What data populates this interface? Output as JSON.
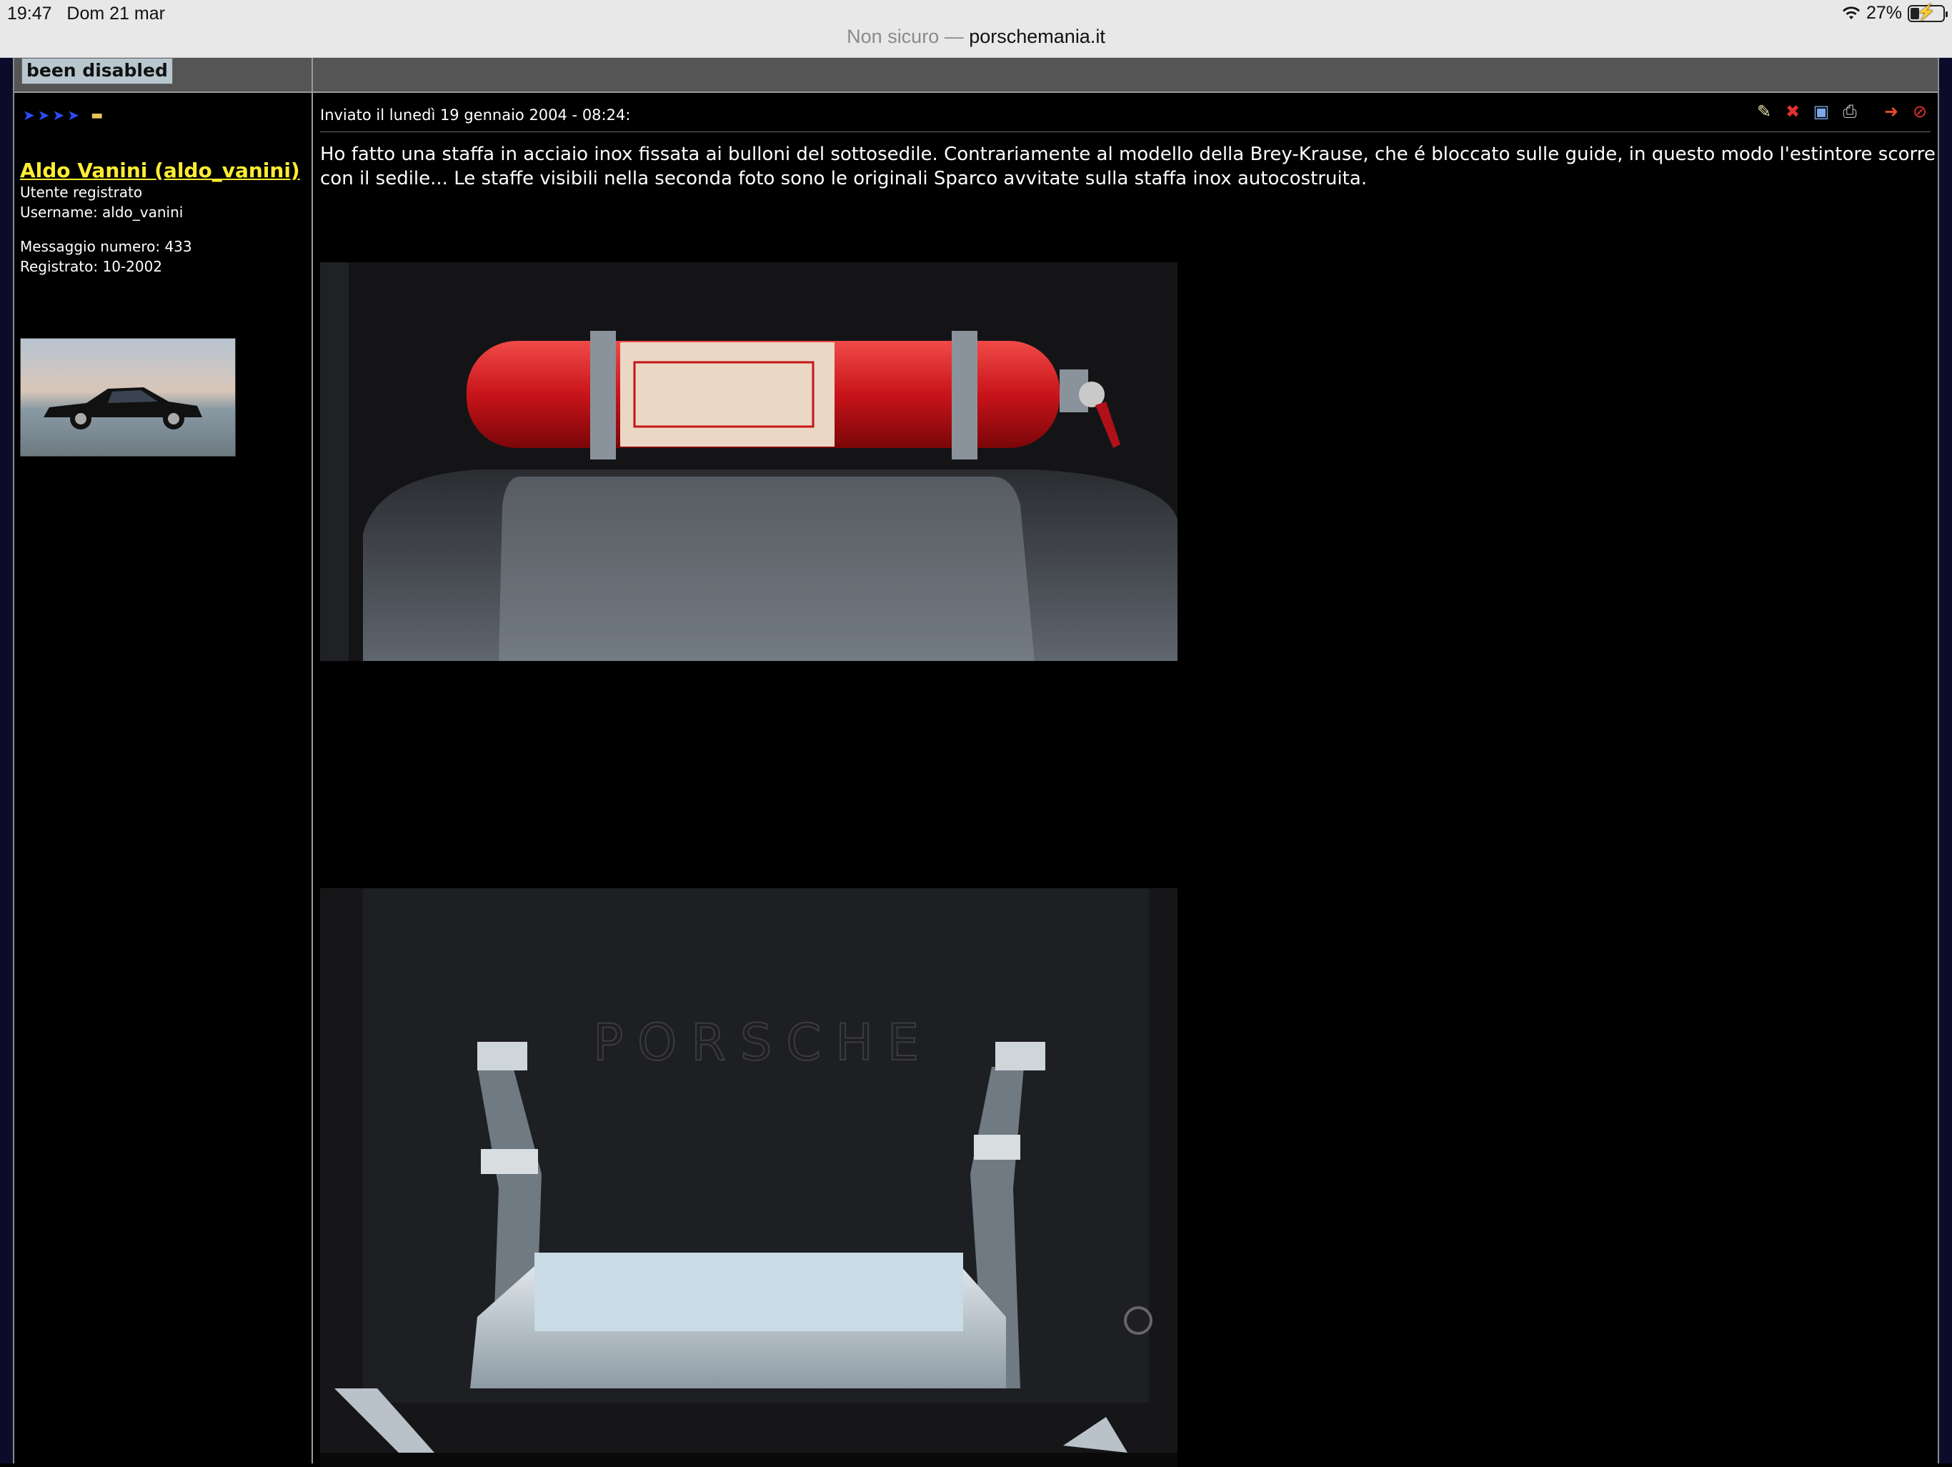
{
  "status_bar": {
    "time": "19:47",
    "date": "Dom 21 mar",
    "battery": "27%",
    "battery_level": 0.27
  },
  "browser": {
    "security_label": "Non sicuro —",
    "domain": "porschemania.it"
  },
  "forum": {
    "disabled_notice": "been disabled"
  },
  "user": {
    "name": "Aldo Vanini (aldo_vanini)",
    "role": "Utente registrato",
    "username": "Username: aldo_vanini",
    "message_count": "Messaggio numero: 433",
    "registered": "Registrato: 10-2002",
    "rank_icons": [
      "rank-star-icon",
      "rank-star-icon",
      "rank-star-icon",
      "rank-star-icon"
    ]
  },
  "post": {
    "date_line": "Inviato il lunedì 19 gennaio 2004 - 08:24:",
    "body": "Ho fatto una staffa in acciaio inox fissata ai bulloni del sottosedile. Contrariamente al modello della Brey-Krause, che é bloccato sulle guide, in questo modo l'estintore scorre con il sedile... Le staffe visibili nella seconda foto sono le originali Sparco avvitate sulla staffa inox autocostruita.",
    "actions": [
      "edit-post-icon",
      "delete-post-icon",
      "ip-icon",
      "print-icon",
      "move-icon",
      "report-icon"
    ]
  },
  "colors": {
    "username": "#ffee33",
    "page_bg": "#000000",
    "rank_star": "#2a4cff"
  }
}
